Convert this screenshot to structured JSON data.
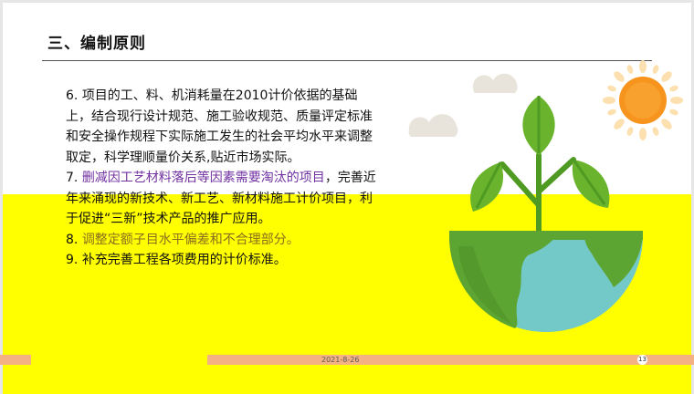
{
  "slide": {
    "title": "三、编制原则",
    "items": [
      {
        "num": "6. ",
        "highlight": "",
        "text": "项目的工、料、机消耗量在2010计价依据的基础上，结合现行设计规范、施工验收规范、质量评定标准和安全操作规程下实际施工发生的社会平均水平来调整取定，科学理顺量价关系,贴近市场实际。"
      },
      {
        "num": "7. ",
        "highlight": "删减因工艺材料落后等因素需要淘汰的项目",
        "text": "，完善近年来涌现的新技术、新工艺、新材料施工计价项目，利于促进“三新”技术产品的推广应用。"
      },
      {
        "num": "8. ",
        "highlight": "调整定额子目水平偏差和不合理部分。",
        "text": ""
      },
      {
        "num": "9. ",
        "highlight": "",
        "text": "补充完善工程各项费用的计价标准。"
      }
    ],
    "footer": {
      "date": "2021-8-26",
      "page": "13"
    }
  },
  "colors": {
    "background_band": "#ffff00",
    "highlight_purple": "#7030a0",
    "highlight_olive": "#8a6d1e",
    "footer_bar": "#f4b183",
    "sun": "#f7941d",
    "leaf": "#6ab42d",
    "globe_water": "#73c8c8",
    "globe_land": "#5da532"
  },
  "icons": [
    "sun-icon",
    "cloud-icon",
    "plant-icon",
    "globe-icon"
  ]
}
